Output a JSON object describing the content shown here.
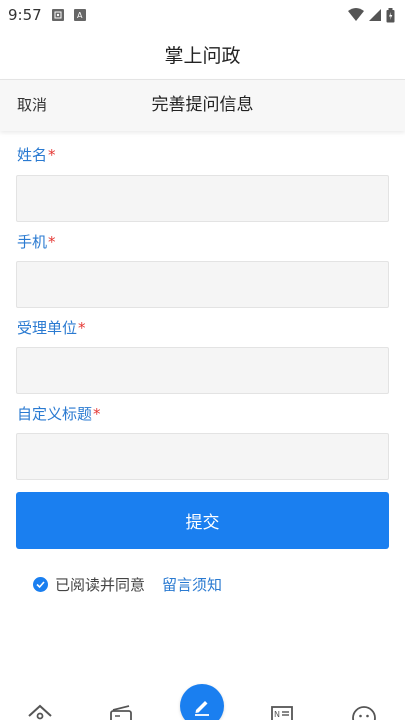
{
  "status_bar": {
    "time": "9:57",
    "notif_icon_1": "image-icon",
    "notif_icon_2": "A",
    "icons": [
      "wifi-icon",
      "signal-icon",
      "battery-icon"
    ]
  },
  "header": {
    "title": "掌上问政"
  },
  "sub_header": {
    "cancel_label": "取消",
    "title": "完善提问信息"
  },
  "form": {
    "required_mark": "*",
    "fields": [
      {
        "label": "姓名",
        "value": ""
      },
      {
        "label": "手机",
        "value": ""
      },
      {
        "label": "受理单位",
        "value": ""
      },
      {
        "label": "自定义标题",
        "value": ""
      }
    ]
  },
  "submit": {
    "label": "提交"
  },
  "agreement": {
    "checked": true,
    "text": "已阅读并同意",
    "link": "留言须知"
  },
  "tab_bar": {
    "items": [
      "home-icon",
      "radio-icon",
      "edit-icon",
      "news-icon",
      "chat-icon"
    ]
  },
  "colors": {
    "accent": "#1a7ff0",
    "label_blue": "#2a7ad1",
    "required": "#e53935"
  }
}
